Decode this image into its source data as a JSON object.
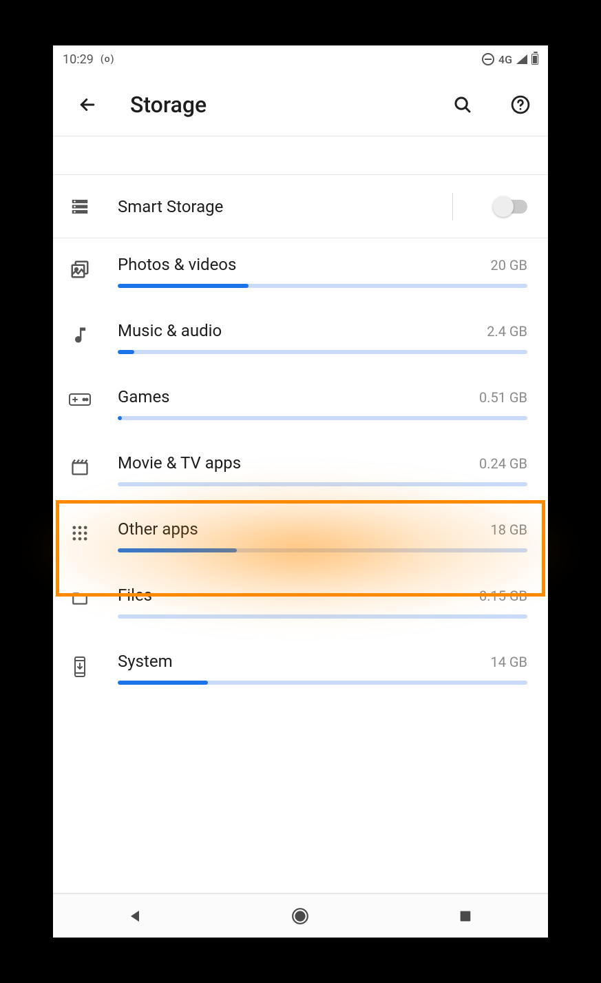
{
  "status": {
    "time": "10:29",
    "network_label": "4G"
  },
  "appbar": {
    "title": "Storage"
  },
  "smart_storage": {
    "label": "Smart Storage",
    "enabled": false
  },
  "categories": [
    {
      "id": "photos",
      "label": "Photos & videos",
      "size": "20 GB",
      "pct": 32
    },
    {
      "id": "music",
      "label": "Music & audio",
      "size": "2.4 GB",
      "pct": 4
    },
    {
      "id": "games",
      "label": "Games",
      "size": "0.51 GB",
      "pct": 1
    },
    {
      "id": "movies",
      "label": "Movie & TV apps",
      "size": "0.24 GB",
      "pct": 0
    },
    {
      "id": "other",
      "label": "Other apps",
      "size": "18 GB",
      "pct": 29
    },
    {
      "id": "files",
      "label": "Files",
      "size": "0.15 GB",
      "pct": 0
    },
    {
      "id": "system",
      "label": "System",
      "size": "14 GB",
      "pct": 22
    }
  ],
  "highlighted_category": "other"
}
